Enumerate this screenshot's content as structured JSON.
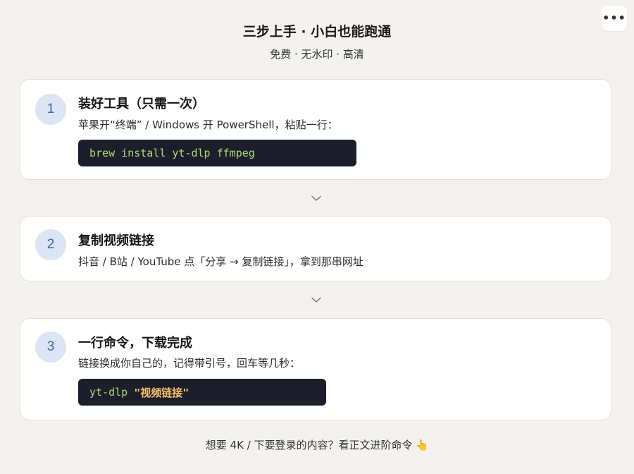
{
  "header": {
    "title": "三步上手 · 小白也能跑通",
    "subtitle": "免费 · 无水印 · 高清",
    "more_icon": "more-horizontal-icon"
  },
  "steps": [
    {
      "number": "1",
      "title": "装好工具（只需一次）",
      "description": "苹果开“终端” / Windows 开 PowerShell，粘贴一行：",
      "code": "brew install yt-dlp ffmpeg"
    },
    {
      "number": "2",
      "title": "复制视频链接",
      "description": "抖音 / B站 / YouTube 点「分享 → 复制链接」，拿到那串网址"
    },
    {
      "number": "3",
      "title": "一行命令，下载完成",
      "description": "链接换成你自己的，记得带引号，回车等几秒：",
      "code_cmd": "yt-dlp ",
      "code_arg": "\"视频链接\""
    }
  ],
  "footer": {
    "text": "想要 4K / 下要登录的内容？看正文进阶命令",
    "hand_emoji": "👆"
  },
  "colors": {
    "background": "#f4f2ee",
    "card": "#ffffff",
    "step_circle": "#dbe5f3",
    "step_number": "#3e66a8",
    "code_bg": "#1d1e2b",
    "code_green": "#a9dc76",
    "code_yellow": "#f5c36a"
  }
}
